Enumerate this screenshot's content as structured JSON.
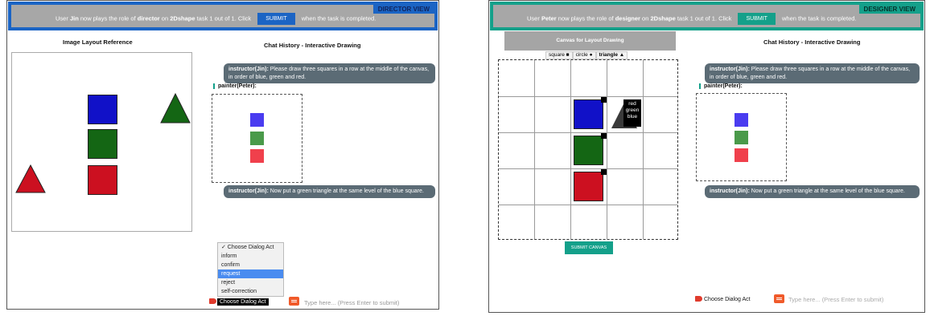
{
  "director": {
    "role_prefix": "User",
    "user": "Jin",
    "role_mid": "now plays the role of",
    "role": "director",
    "task_mid": "on",
    "task": "2Dshape",
    "task_suffix": "task 1 out of 1. Click",
    "submit_label": "SUBMIT",
    "after_submit": "when the task is completed.",
    "view_label": "DIRECTOR VIEW",
    "reference_title": "Image Layout Reference",
    "chat_title": "Chat History - Interactive Drawing",
    "chat": {
      "msg1_speaker": "instructor(Jin):",
      "msg1_text": "Please draw three squares in a row at the middle of the canvas, in order of blue, green and red.",
      "painter_label": "painter(Peter):",
      "msg2_speaker": "instructor(Jin):",
      "msg2_text": "Now put a green triangle at the same level of the blue square."
    },
    "dialog_options": [
      "✓ Choose Dialog Act",
      "inform",
      "confirm",
      "request",
      "reject",
      "self-correction"
    ],
    "dialog_selected": "Choose Dialog Act",
    "type_placeholder": "Type here... (Press Enter to submit)"
  },
  "designer": {
    "role_prefix": "User",
    "user": "Peter",
    "role_mid": "now plays the role of",
    "role": "designer",
    "task_mid": "on",
    "task": "2Dshape",
    "task_suffix": "task 1 out of 1. Click",
    "submit_label": "SUBMIT",
    "after_submit": "when the task is completed.",
    "view_label": "DESIGNER VIEW",
    "canvas_title": "Canvas for Layout Drawing",
    "chat_title": "Chat History - Interactive Drawing",
    "shape_tabs": [
      "square ■",
      "circle ●",
      "triangle ▲"
    ],
    "color_options": [
      "red",
      "green",
      "blue"
    ],
    "submit_canvas_label": "SUBMIT CANVAS",
    "chat": {
      "msg1_speaker": "instructor(Jin):",
      "msg1_text": "Please draw three squares in a row at the middle of the canvas, in order of blue, green and red.",
      "painter_label": "painter(Peter):",
      "msg2_speaker": "instructor(Jin):",
      "msg2_text": "Now put a green triangle at the same level of the blue square."
    },
    "dialog_selected": "Choose Dialog Act",
    "type_placeholder": "Type here... (Press Enter to submit)"
  },
  "colors": {
    "blue": "#1111c8",
    "green": "#146614",
    "red": "#cc1020",
    "mini_blue": "#4a3cf0",
    "mini_green": "#4a9a4a",
    "mini_red": "#f0404c"
  }
}
